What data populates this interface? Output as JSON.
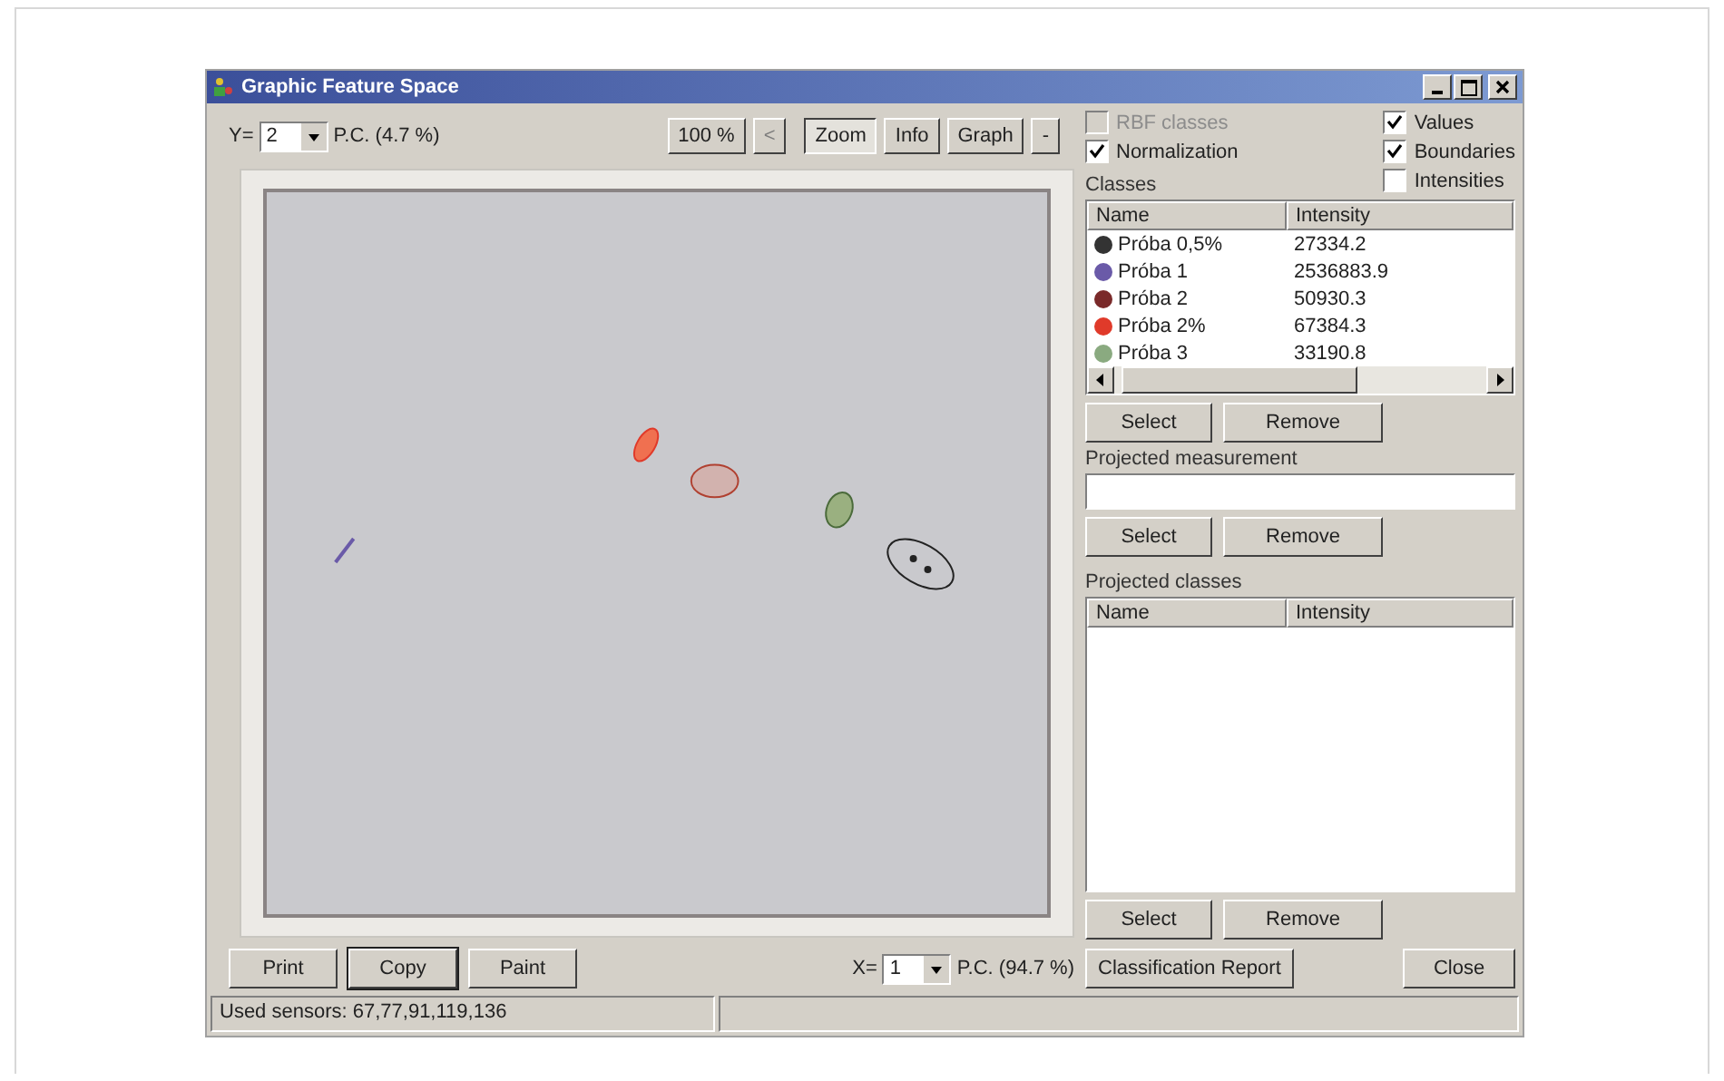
{
  "window": {
    "title": "Graphic Feature Space"
  },
  "y_axis": {
    "label": "Y=",
    "value": "2",
    "caption": "P.C. (4.7 %)"
  },
  "toolbar": [
    {
      "label": "100 %",
      "selected": false,
      "disabled": false
    },
    {
      "label": "<",
      "selected": false,
      "disabled": true
    },
    {
      "label": "Zoom",
      "selected": true,
      "disabled": false
    },
    {
      "label": "Info",
      "selected": false,
      "disabled": false
    },
    {
      "label": "Graph",
      "selected": false,
      "disabled": false
    },
    {
      "label": "-",
      "selected": false,
      "disabled": false
    }
  ],
  "options_left": [
    {
      "label": "RBF classes",
      "checked": false,
      "disabled": true
    },
    {
      "label": "Normalization",
      "checked": true,
      "disabled": false
    }
  ],
  "options_right": [
    {
      "label": "Values",
      "checked": true,
      "disabled": false
    },
    {
      "label": "Boundaries",
      "checked": true,
      "disabled": false
    },
    {
      "label": "Intensities",
      "checked": false,
      "disabled": false
    }
  ],
  "classes": {
    "label": "Classes",
    "columns": [
      "Name",
      "Intensity"
    ],
    "rows": [
      {
        "name": "Próba 0,5%",
        "intensity": "27334.2",
        "color": "#333333"
      },
      {
        "name": "Próba 1",
        "intensity": "2536883.9",
        "color": "#6a5aa8"
      },
      {
        "name": "Próba 2",
        "intensity": "50930.3",
        "color": "#7a2a2a"
      },
      {
        "name": "Próba 2%",
        "intensity": "67384.3",
        "color": "#e03a2a"
      },
      {
        "name": "Próba 3",
        "intensity": "33190.8",
        "color": "#8aaa80"
      }
    ],
    "buttons": [
      "Select",
      "Remove"
    ]
  },
  "projected_measurement": {
    "label": "Projected measurement",
    "buttons": [
      "Select",
      "Remove"
    ]
  },
  "projected_classes": {
    "label": "Projected classes",
    "columns": [
      "Name",
      "Intensity"
    ],
    "buttons": [
      "Select",
      "Remove"
    ]
  },
  "bottom_buttons": [
    {
      "label": "Print",
      "focused": false
    },
    {
      "label": "Copy",
      "focused": true
    },
    {
      "label": "Paint",
      "focused": false
    }
  ],
  "x_axis": {
    "label": "X=",
    "value": "1",
    "caption": "P.C. (94.7 %)"
  },
  "report_button": "Classification Report",
  "close_button": "Close",
  "status_bar": {
    "text": "Used sensors: 67,77,91,119,136"
  }
}
